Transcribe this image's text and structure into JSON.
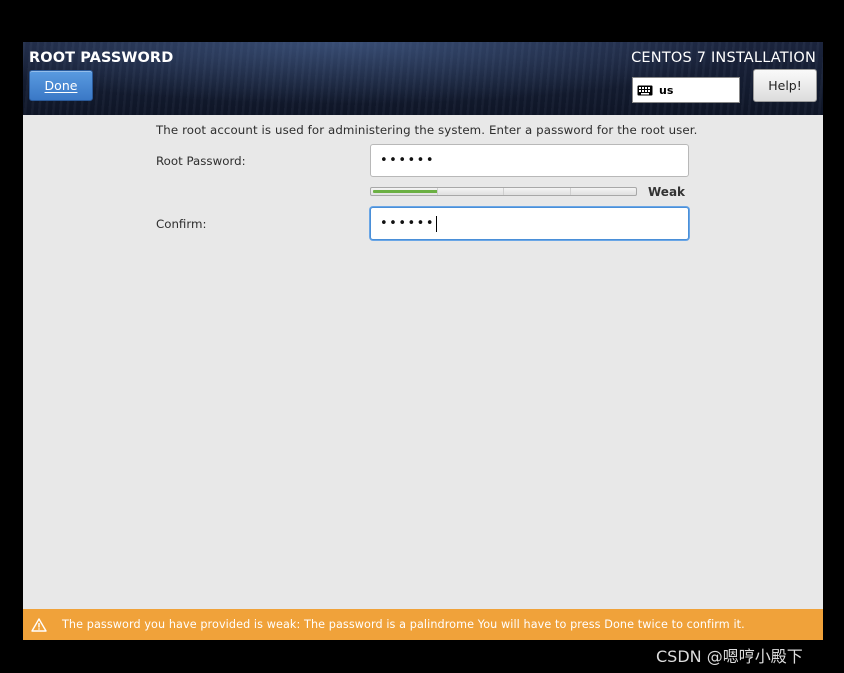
{
  "header": {
    "page_title": "ROOT PASSWORD",
    "done_label": "Done",
    "installer_title": "CENTOS 7 INSTALLATION",
    "keyboard_layout": "us",
    "help_label": "Help!"
  },
  "form": {
    "description": "The root account is used for administering the system.  Enter a password for the root user.",
    "root_password_label": "Root Password:",
    "root_password_value": "••••••",
    "confirm_label": "Confirm:",
    "confirm_value": "••••••",
    "strength_label": "Weak",
    "strength_level": 0.25
  },
  "warning": {
    "message": "The password you have provided is weak: The password is a palindrome You will have to press Done twice to confirm it.",
    "icon": "warning-icon"
  },
  "watermark": "CSDN @嗯哼小殿下",
  "colors": {
    "done_button": "#3a78c6",
    "warning_bar": "#f0a23a",
    "strength_fill": "#6bb043",
    "focus_border": "#4a8fd8"
  }
}
